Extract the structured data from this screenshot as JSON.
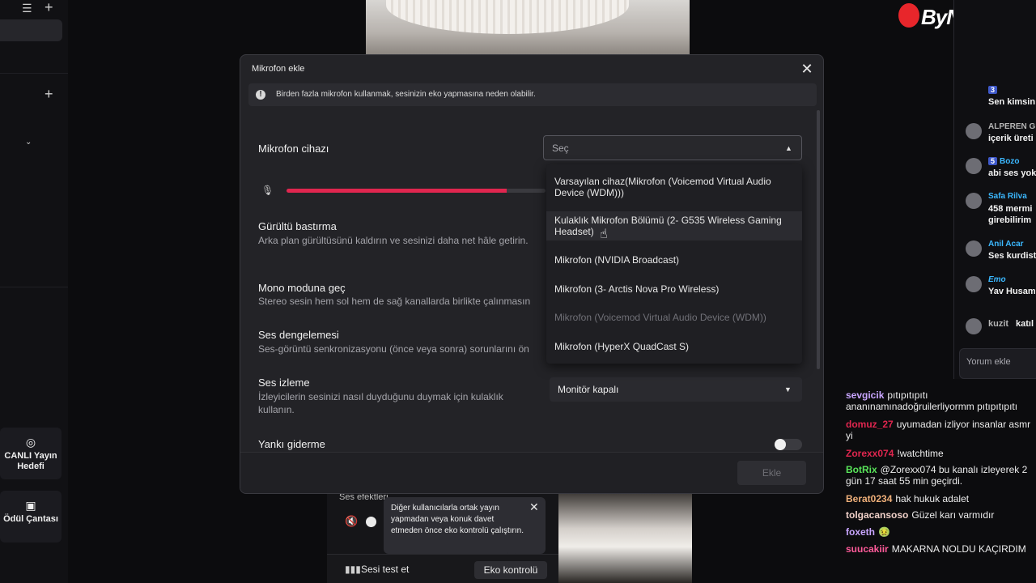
{
  "rail": {
    "goal_label": "CANLI Yayın Hedefi",
    "reward_label": "Ödül Çantası"
  },
  "logo": {
    "text": "ByNoGame"
  },
  "comments": [
    {
      "name": "",
      "text": "Sen kimsin",
      "name_color": "#9aa0ff",
      "badge": ""
    },
    {
      "name": "ALPEREN GÜ",
      "text": "içerik üreti",
      "name_color": "#b5b5b5",
      "badge": ""
    },
    {
      "name": "Bozo",
      "text": "abi ses yok",
      "name_color": "#3bb8ff",
      "badge": "5"
    },
    {
      "name": "Safa Rilva",
      "text": "458 mermi girebilirim",
      "name_color": "#3bb8ff",
      "badge": ""
    },
    {
      "name": "Anil Acar",
      "text": "Ses kurdist",
      "name_color": "#3bb8ff",
      "badge": ""
    },
    {
      "name": "Emo",
      "text": "Yav Husam",
      "name_color": "#3bb8ff",
      "badge": ""
    },
    {
      "name": "kuzit",
      "text": "katıl",
      "name_color": "#b5b5b5",
      "badge": ""
    }
  ],
  "comment_input": {
    "placeholder": "Yorum ekle"
  },
  "chat": [
    {
      "name": "sevgicik",
      "color": "#c9a6ff",
      "msg": "pıtıpıtıpıtı ananınamınadoğruilerliyormm pıtıpıtıpıtı"
    },
    {
      "name": "domuz_27",
      "color": "#e0264f",
      "msg": "uyumadan izliyor insanlar asmr yi"
    },
    {
      "name": "Zorexx074",
      "color": "#e0264f",
      "msg": "!watchtime"
    },
    {
      "name": "BotRix",
      "color": "#59e55a",
      "msg": "@Zorexx074 bu kanalı izleyerek 2 gün 17 saat 55 min geçirdi."
    },
    {
      "name": "Berat0234",
      "color": "#f0b07a",
      "msg": "hak hukuk adalet"
    },
    {
      "name": "tolgacansoso",
      "color": "#f0d0c8",
      "msg": "Güzel karı varmıdır"
    },
    {
      "name": "foxeth",
      "color": "#c9a6ff",
      "msg": "🤢"
    },
    {
      "name": "suucakiir",
      "color": "#ff5b9a",
      "msg": "MAKARNA NOLDU KAÇIRDIM"
    }
  ],
  "modal": {
    "title": "Mikrofon ekle",
    "notice": "Birden fazla mikrofon kullanmak, sesinizin eko yapmasına neden olabilir.",
    "device_label": "Mikrofon cihazı",
    "device_placeholder": "Seç",
    "mic_level": 0.85,
    "noise": {
      "label": "Gürültü bastırma",
      "desc": "Arka plan gürültüsünü kaldırın ve sesinizi daha net hâle getirin."
    },
    "mono": {
      "label": "Mono moduna geç",
      "desc": "Stereo sesin hem sol hem de sağ kanallarda birlikte çalınmasın"
    },
    "balance": {
      "label": "Ses dengelemesi",
      "desc": "Ses-görüntü senkronizasyonu (önce veya sonra) sorunlarını ön"
    },
    "monitor": {
      "label": "Ses izleme",
      "desc": "İzleyicilerin sesinizi nasıl duyduğunu duymak için kulaklık kullanın.",
      "value": "Monitör kapalı"
    },
    "echo": {
      "label": "Yankı giderme"
    },
    "add_button": "Ekle"
  },
  "dropdown": [
    {
      "label": "Varsayılan cihaz(Mikrofon (Voicemod Virtual Audio Device (WDM)))",
      "state": "normal"
    },
    {
      "label": "Kulaklık Mikrofon Bölümü (2- G535 Wireless Gaming Headset)",
      "state": "hover"
    },
    {
      "label": "Mikrofon (NVIDIA Broadcast)",
      "state": "normal"
    },
    {
      "label": "Mikrofon (3- Arctis Nova Pro Wireless)",
      "state": "normal"
    },
    {
      "label": "Mikrofon (Voicemod Virtual Audio Device (WDM))",
      "state": "disabled"
    },
    {
      "label": "Mikrofon (HyperX QuadCast S)",
      "state": "normal"
    }
  ],
  "audio": {
    "effects_label": "Ses efektleri",
    "tooltip": "Diğer kullanıcılarla ortak yayın yapmadan veya konuk davet etmeden önce eko kontrolü çalıştırın.",
    "test_label": "Sesi test et",
    "echo_button": "Eko kontrolü"
  }
}
